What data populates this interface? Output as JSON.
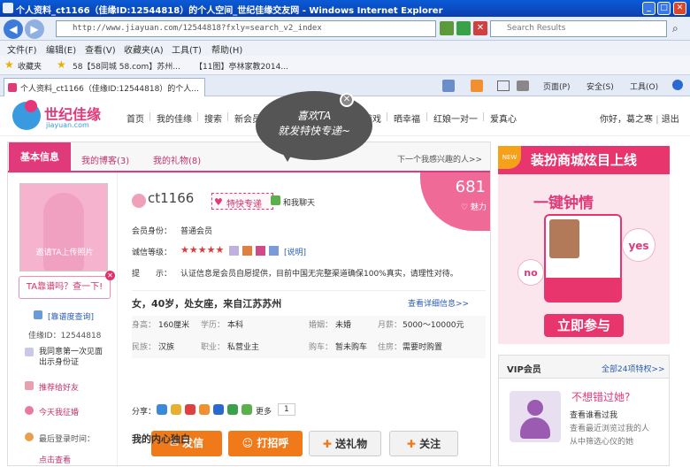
{
  "window": {
    "title": "个人资料_ct1166（佳缘ID:12544818）的个人空间_世纪佳缘交友网 - Windows Internet Explorer",
    "minimize": "_",
    "maximize": "□",
    "close": "✕"
  },
  "address_bar": {
    "url": "http://www.jiayuan.com/12544818?fxly=search_v2_index",
    "search_placeholder": "Search Results"
  },
  "menu": [
    "文件(F)",
    "编辑(E)",
    "查看(V)",
    "收藏夹(A)",
    "工具(T)",
    "帮助(H)"
  ],
  "favorites_bar": {
    "favorites": "收藏夹",
    "items": [
      "58【58同城 58.com】苏州...",
      "【11图】亭林家教2014..."
    ]
  },
  "tab": {
    "label": "个人资料_ct1166（佳缘ID:12544818）的个人...",
    "commands": [
      "页面(P)",
      "安全(S)",
      "工具(O)"
    ]
  },
  "site": {
    "logo_name": "世纪佳缘",
    "logo_domain": "jiayuan.com",
    "nav": [
      "首页",
      "我的佳缘",
      "搜索",
      "新会员",
      "聊天",
      "活动",
      "两性",
      "游戏",
      "晒幸福",
      "红娘一对一",
      "爱真心"
    ],
    "greeting": "你好，葛之寒",
    "logout": "退出"
  },
  "profile_tabs": {
    "basic": "基本信息",
    "blog": "我的博客(3)",
    "gifts": "我的礼物(8)",
    "next_user": "下一个我感兴趣的人>>"
  },
  "bubble": {
    "line1": "喜欢TA",
    "line2": "就发特快专递~",
    "close": "✕"
  },
  "charm": {
    "value": "681",
    "label": "魅力"
  },
  "left_column": {
    "photo_label": "邀请TA上传照片",
    "ask": "TA靠谱吗？查一下!",
    "ask_close": "✕",
    "reliability": "[靠谱度查询]",
    "id_line": "佳缘ID：12544818",
    "qa1": "我同意第一次见面出示身份证",
    "recommend": "推荐给好友",
    "today_cert": "今天我征婚",
    "last_login": "最后登录时间：",
    "click_view": "点击查看"
  },
  "profile": {
    "username": "ct1166",
    "express": "特快专递",
    "chat": "和我聊天",
    "membership_label": "会员身份：",
    "membership": "普通会员",
    "credit_label": "诚信等级：",
    "credit_stars": "★★★★★",
    "credit_desc": "[说明]",
    "tip_label": "提　　示：",
    "tip": "认证信息是会员自愿提供，目前中国无完整渠道确保100%真实，请理性对待。",
    "summary": "女，40岁，处女座，来自江苏苏州",
    "detail_link": "查看详细信息>>",
    "grid": [
      {
        "label": "身高：",
        "value": "160厘米"
      },
      {
        "label": "学历：",
        "value": "本科"
      },
      {
        "label": "婚姻：",
        "value": "未婚"
      },
      {
        "label": "月薪：",
        "value": "5000～10000元"
      },
      {
        "label": "民族：",
        "value": "汉族"
      },
      {
        "label": "职业：",
        "value": "私营业主"
      },
      {
        "label": "购车：",
        "value": "暂未购车"
      },
      {
        "label": "住房：",
        "value": "需要时购置"
      }
    ],
    "share_label": "分享：",
    "share_more": "更多",
    "share_count": "1",
    "buttons": {
      "letter": "发信",
      "greet": "打招呼",
      "gift": "送礼物",
      "follow": "关注"
    },
    "heart_title": "我的内心独白"
  },
  "ad": {
    "new_badge": "NEW",
    "title": "装扮商城炫目上线",
    "slogan": "一键钟情",
    "yes": "yes",
    "no": "no",
    "join": "立即参与"
  },
  "vip": {
    "title": "VIP会员",
    "all_link": "全部24项特权>>",
    "miss": "不想错过她?",
    "line1": "查看谁看过我",
    "line2": "查看最近浏览过我的人",
    "line3": "从中筛选心仪的她"
  },
  "colors": {
    "brand_pink": "#e03a7a",
    "ie_blue": "#0a5bd6",
    "btn_orange": "#f07a1a",
    "link_blue": "#2a5db0"
  }
}
